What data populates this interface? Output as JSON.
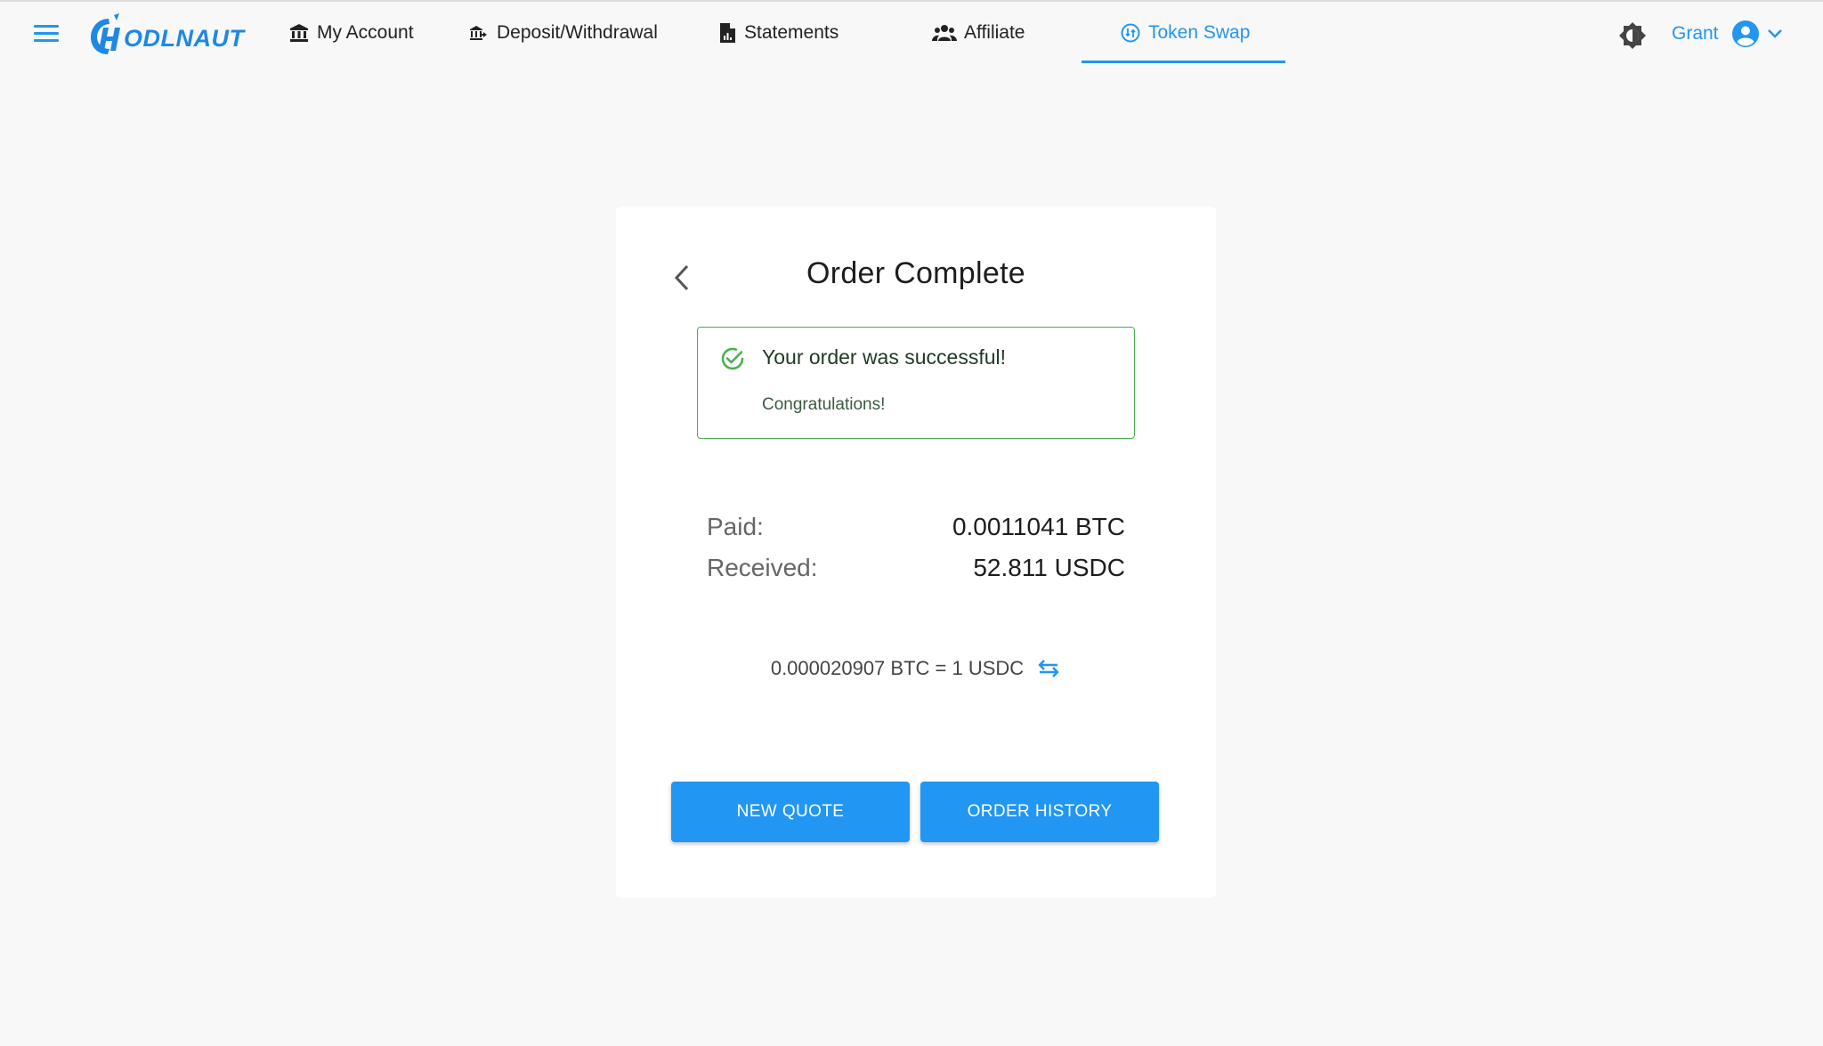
{
  "brand": {
    "logo_text": "ODLNAUT",
    "accent": "#2196f3",
    "success": "#4caf50"
  },
  "nav": {
    "items": [
      {
        "label": "My Account",
        "icon": "bank-icon"
      },
      {
        "label": "Deposit/Withdrawal",
        "icon": "deposit-withdraw-icon"
      },
      {
        "label": "Statements",
        "icon": "document-icon"
      },
      {
        "label": "Affiliate",
        "icon": "people-icon"
      },
      {
        "label": "Token Swap",
        "icon": "swap-circle-icon",
        "active": true
      }
    ]
  },
  "user": {
    "name": "Grant"
  },
  "card": {
    "title": "Order Complete",
    "alert": {
      "title": "Your order was successful!",
      "subtitle": "Congratulations!"
    },
    "summary": {
      "paid_label": "Paid:",
      "paid_value": "0.0011041 BTC",
      "received_label": "Received:",
      "received_value": "52.811 USDC"
    },
    "rate": "0.000020907 BTC = 1 USDC",
    "buttons": {
      "new_quote": "NEW QUOTE",
      "order_history": "ORDER HISTORY"
    }
  }
}
